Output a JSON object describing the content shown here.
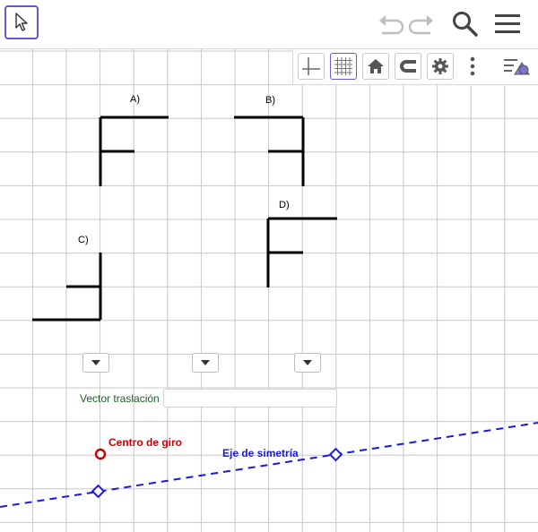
{
  "toolbar": {
    "move_tool": "move-tool",
    "undo": "undo",
    "redo": "redo",
    "search": "search",
    "menu": "menu"
  },
  "style_bar": {
    "buttons": [
      "axes",
      "grid",
      "home",
      "snap",
      "settings",
      "more",
      "toggle-style-bar"
    ]
  },
  "graphics": {
    "labels": {
      "a": "A)",
      "b": "B)",
      "c": "C)",
      "d": "D)",
      "centro": "Centro de giro",
      "eje": "Eje de simetría"
    },
    "colors": {
      "grid": "#c8c8c8",
      "figure": "#000000",
      "centro": "#cc0000",
      "eje": "#1a1ae0",
      "label_green": "#1b5e20"
    }
  },
  "controls": {
    "dropdowns": [
      "",
      "",
      ""
    ],
    "vector_label": "Vector traslación",
    "vector_value": ""
  }
}
